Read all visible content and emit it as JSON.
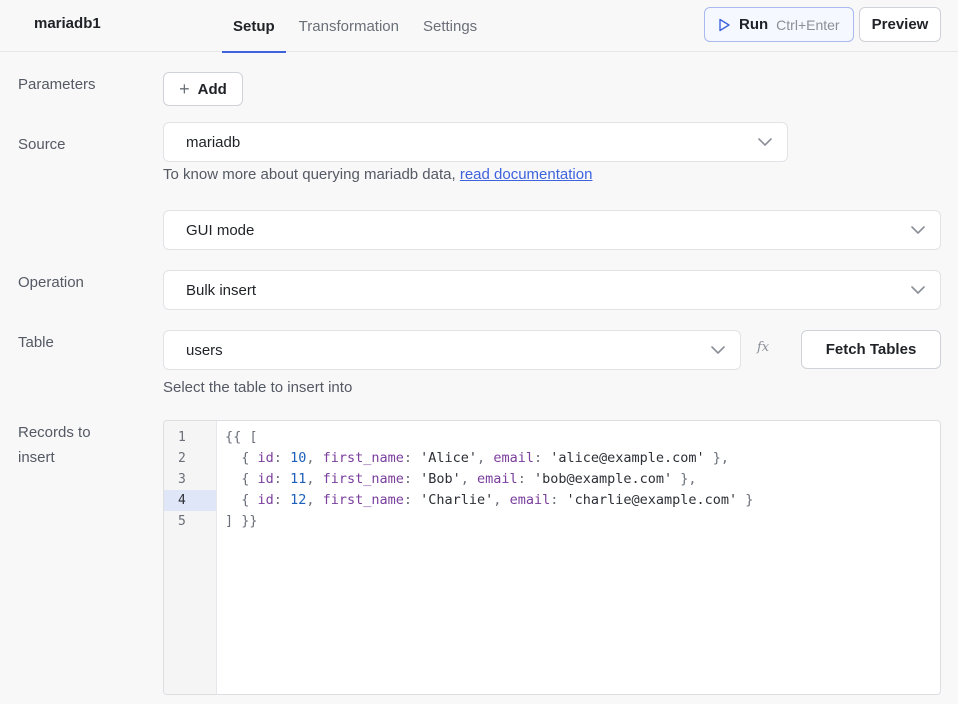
{
  "header": {
    "query_name": "mariadb1",
    "tabs": [
      {
        "label": "Setup",
        "active": true
      },
      {
        "label": "Transformation",
        "active": false
      },
      {
        "label": "Settings",
        "active": false
      }
    ],
    "run_label": "Run",
    "run_shortcut": "Ctrl+Enter",
    "preview_label": "Preview"
  },
  "form": {
    "parameters_label": "Parameters",
    "add_label": "Add",
    "source_label": "Source",
    "source_value": "mariadb",
    "source_hint_text": "To know more about querying mariadb data, ",
    "source_hint_link": "read documentation",
    "mode_value": "GUI mode",
    "operation_label": "Operation",
    "operation_value": "Bulk insert",
    "table_label": "Table",
    "table_value": "users",
    "fx_label": "fx",
    "fetch_tables_label": "Fetch Tables",
    "table_hint": "Select the table to insert into",
    "records_label_line1": "Records to",
    "records_label_line2": "insert"
  },
  "editor": {
    "line_numbers": [
      "1",
      "2",
      "3",
      "4",
      "5"
    ],
    "active_line": 4,
    "records": [
      {
        "id": "10",
        "first_name": "'Alice'",
        "email": "'alice@example.com'"
      },
      {
        "id": "11",
        "first_name": "'Bob'",
        "email": "'bob@example.com'"
      },
      {
        "id": "12",
        "first_name": "'Charlie'",
        "email": "'charlie@example.com'"
      }
    ],
    "open_line": "{{ [",
    "close_line": "] }}",
    "key_id": "id",
    "key_first_name": "first_name",
    "key_email": "email"
  },
  "colors": {
    "accent": "#3e63dd",
    "keyword": "#7a3e9d",
    "number": "#1c5fb8"
  },
  "icons": {
    "run": "play-icon",
    "add": "plus-icon",
    "dropdown": "chevron-down-icon"
  }
}
